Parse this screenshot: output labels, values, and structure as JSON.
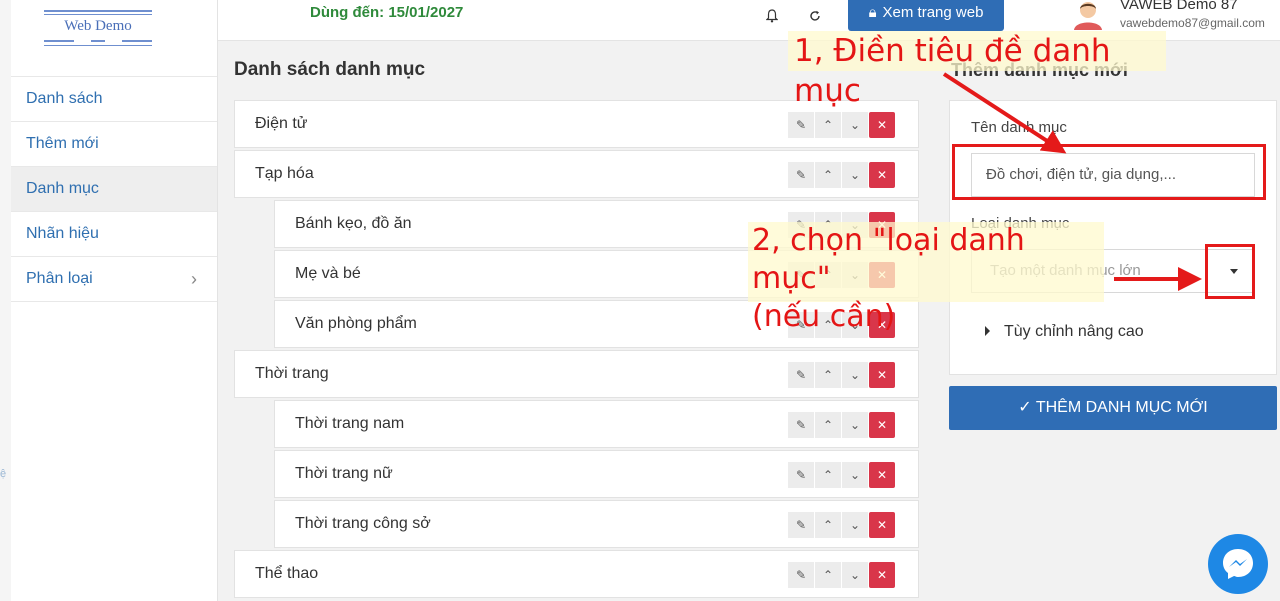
{
  "brand": {
    "logo_text": "Web Demo"
  },
  "header": {
    "expiry": "Dùng đến: 15/01/2027",
    "view_site_label": "Xem trang web",
    "user_name": "VAWEB Demo 87",
    "user_email": "vawebdemo87@gmail.com"
  },
  "left_strip": {
    "text": "ệ"
  },
  "sidebar": {
    "items": [
      {
        "label": "Danh sách",
        "active": false
      },
      {
        "label": "Thêm mới",
        "active": false
      },
      {
        "label": "Danh mục",
        "active": true
      },
      {
        "label": "Nhãn hiệu",
        "active": false
      },
      {
        "label": "Phân loại",
        "active": false,
        "has_submenu": true
      }
    ]
  },
  "main": {
    "title": "Danh sách danh mục",
    "categories": [
      {
        "label": "Điện tử",
        "level": 0
      },
      {
        "label": "Tạp hóa",
        "level": 0
      },
      {
        "label": "Bánh kẹo, đồ ăn",
        "level": 1
      },
      {
        "label": "Mẹ và bé",
        "level": 1
      },
      {
        "label": "Văn phòng phẩm",
        "level": 1
      },
      {
        "label": "Thời trang",
        "level": 0
      },
      {
        "label": "Thời trang nam",
        "level": 1
      },
      {
        "label": "Thời trang nữ",
        "level": 1
      },
      {
        "label": "Thời trang công sở",
        "level": 1
      },
      {
        "label": "Thể thao",
        "level": 0
      }
    ],
    "row_actions": {
      "edit_icon": "pencil-icon",
      "up_icon": "chevron-up-icon",
      "down_icon": "chevron-down-icon",
      "delete_icon": "close-circle-icon"
    }
  },
  "panel": {
    "title": "Thêm danh mục mới",
    "name_label": "Tên danh mục",
    "name_placeholder": "Đồ chơi, điện tử, gia dụng,...",
    "type_label": "Loại danh mục",
    "type_value": "Tạo một danh mục lớn",
    "advanced_label": "Tùy chỉnh nâng cao",
    "submit_label": "✓ THÊM DANH MỤC MỚI"
  },
  "annotations": {
    "step1": "1, Điền tiêu đề danh mục",
    "step2_line1": "2, chọn \"loại danh mục\"",
    "step2_line2": "(nếu cần)"
  },
  "colors": {
    "primary": "#2f6db5",
    "link": "#2f6fb0",
    "expiry": "#2f8a3b",
    "delete": "#d9364a",
    "annotation_red": "#e41515",
    "messenger": "#1e88e5"
  }
}
